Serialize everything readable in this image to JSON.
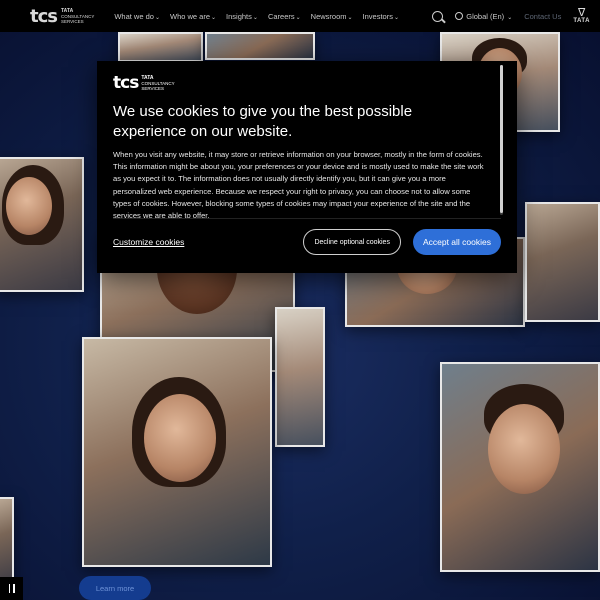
{
  "header": {
    "logo": {
      "mark": "tcs",
      "line1": "TATA",
      "line2": "CONSULTANCY",
      "line3": "SERVICES"
    },
    "nav": [
      {
        "label": "What we do"
      },
      {
        "label": "Who we are"
      },
      {
        "label": "Insights"
      },
      {
        "label": "Careers"
      },
      {
        "label": "Newsroom"
      },
      {
        "label": "Investors"
      }
    ],
    "region": "Global (En)",
    "contact": "Contact Us",
    "tata_word": "TATA"
  },
  "cookie_modal": {
    "logo": {
      "mark": "tcs",
      "line1": "TATA",
      "line2": "CONSULTANCY",
      "line3": "SERVICES"
    },
    "title": "We use cookies to give you the best possible experience on our website.",
    "body": "When you visit any website, it may store or retrieve information on your browser, mostly in the form of cookies. This information might be about you, your preferences or your device and is mostly used to make the site work as you expect it to. The information does not usually directly identify you, but it can give you a more personalized web experience. Because we respect your right to privacy, you can choose not to allow some types of cookies. However, blocking some types of cookies may impact your experience of the site and the services we are able to offer.",
    "customize_label": "Customize cookies",
    "decline_label": "Decline optional cookies",
    "accept_label": "Accept all cookies"
  },
  "hero": {
    "learn_more_label": "Learn more"
  },
  "colors": {
    "accent": "#2e6fd8",
    "header_bg": "#000000",
    "hero_bg": "#10204a"
  }
}
